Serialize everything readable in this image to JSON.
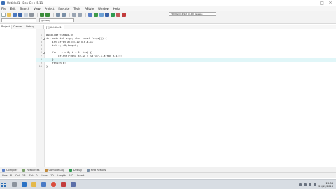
{
  "window": {
    "title": "Untitled1 - Dev-C++ 5.11"
  },
  "menu": [
    "File",
    "Edit",
    "Search",
    "View",
    "Project",
    "Execute",
    "Tools",
    "AStyle",
    "Window",
    "Help"
  ],
  "toolbar": {
    "compiler": "TDM-GCC 4.9.2 64-bit Release",
    "globals": "(globals)"
  },
  "left_panel": {
    "tabs": [
      "Project",
      "Classes",
      "Debug"
    ]
  },
  "editor": {
    "tab": "[*] Untitled1",
    "lines": [
      {
        "num": "1",
        "code": "#include <stdio.h>",
        "fold": false
      },
      {
        "num": "2",
        "code": "int main(int argc, char const *argv[]) {",
        "fold": true
      },
      {
        "num": "3",
        "code": "    int array_A[5]={10,5,6,4,1};",
        "fold": false
      },
      {
        "num": "4",
        "code": "    int i,j=0,temp=0;",
        "fold": false
      },
      {
        "num": "5",
        "code": "",
        "fold": false
      },
      {
        "num": "6",
        "code": "    for ( i = 0; i < 5; i++) {",
        "fold": true
      },
      {
        "num": "7",
        "code": "        printf(\"Data ke-%d : %d \\n\",i,array_A[i]);",
        "fold": false
      },
      {
        "num": "8",
        "code": "    }",
        "fold": false
      },
      {
        "num": "9",
        "code": "    return 0;",
        "fold": false
      },
      {
        "num": "10",
        "code": "}",
        "fold": false
      }
    ]
  },
  "bottom_tabs": [
    "Compiler",
    "Resources",
    "Compile Log",
    "Debug",
    "Find Results"
  ],
  "status": [
    {
      "label": "Line:",
      "value": "8"
    },
    {
      "label": "Col:",
      "value": "13"
    },
    {
      "label": "Sel:",
      "value": "0"
    },
    {
      "label": "Lines:",
      "value": "10"
    },
    {
      "label": "Length:",
      "value": "182"
    },
    {
      "label": "",
      "value": "Insert"
    }
  ],
  "taskbar": {
    "time": "23:34",
    "date": "29/12/2018"
  },
  "colors": {
    "line_highlight": "#e0f6f8",
    "taskbar": "#d8dde3"
  }
}
